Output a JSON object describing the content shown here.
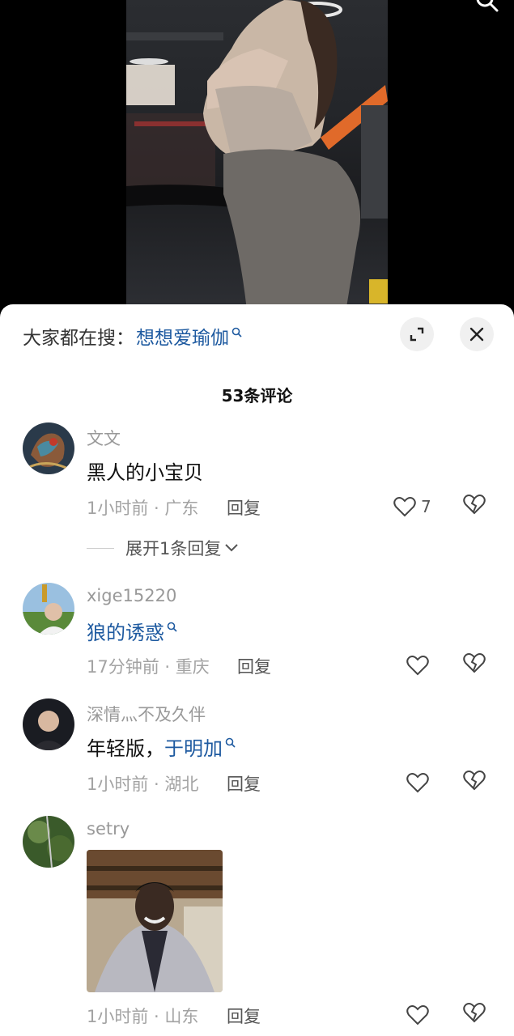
{
  "hot_search": {
    "prefix": "大家都在搜：",
    "keyword": "想想爱瑜伽"
  },
  "comments_count_label": "53条评论",
  "comments": [
    {
      "username": "文文",
      "text": "黑人的小宝贝",
      "meta": "1小时前 · 广东",
      "reply_label": "回复",
      "likes": "7",
      "expand_label": "展开1条回复"
    },
    {
      "username": "xige15220",
      "keyword": "狼的诱惑",
      "meta": "17分钟前 · 重庆",
      "reply_label": "回复"
    },
    {
      "username": "深情灬不及久伴",
      "text": "年轻版，",
      "keyword": "于明加",
      "meta": "1小时前 · 湖北",
      "reply_label": "回复"
    },
    {
      "username": "setry",
      "meta": "1小时前 · 山东",
      "reply_label": "回复"
    }
  ],
  "colors": {
    "link_blue": "#1e5aa0",
    "meta_gray": "#a3a3a3"
  },
  "icons": [
    "search-icon",
    "expand-icon",
    "close-icon",
    "heart-icon",
    "broken-heart-icon",
    "chevron-down-icon"
  ]
}
